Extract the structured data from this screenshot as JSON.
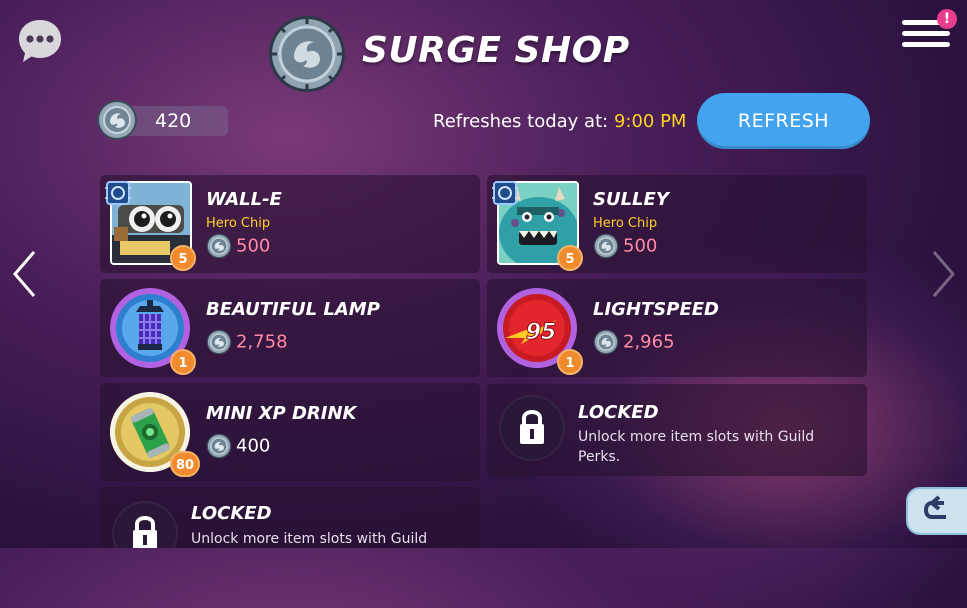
{
  "header": {
    "title": "SURGE SHOP",
    "notification_badge": "!",
    "chat_icon": "chat-bubble-icon",
    "menu_icon": "hamburger-menu-icon"
  },
  "currency": {
    "amount": "420",
    "icon": "surge-coin-icon"
  },
  "refresh": {
    "label": "Refreshes today at:",
    "time": "9:00 PM",
    "button_label": "REFRESH"
  },
  "items": [
    {
      "name": "WALL-E",
      "type": "Hero Chip",
      "price": "500",
      "quantity": "5"
    },
    {
      "name": "SULLEY",
      "type": "Hero Chip",
      "price": "500",
      "quantity": "5"
    },
    {
      "name": "BEAUTIFUL LAMP",
      "price": "2,758",
      "quantity": "1"
    },
    {
      "name": "LIGHTSPEED",
      "price": "2,965",
      "quantity": "1"
    },
    {
      "name": "MINI XP DRINK",
      "price": "400",
      "quantity": "80"
    }
  ],
  "locked": {
    "title": "LOCKED",
    "description": "Unlock more item slots with Guild Perks.",
    "truncated_description": "Unlock more item slots with Guild"
  },
  "lightspeed_art_text": "95",
  "colors": {
    "refresh_button": "#44a3ee",
    "price_pink": "#ff8aa5",
    "hero_chip_yellow": "#ffcf2a",
    "quantity_badge": "#f08a2c",
    "notification": "#ea3d8f"
  }
}
